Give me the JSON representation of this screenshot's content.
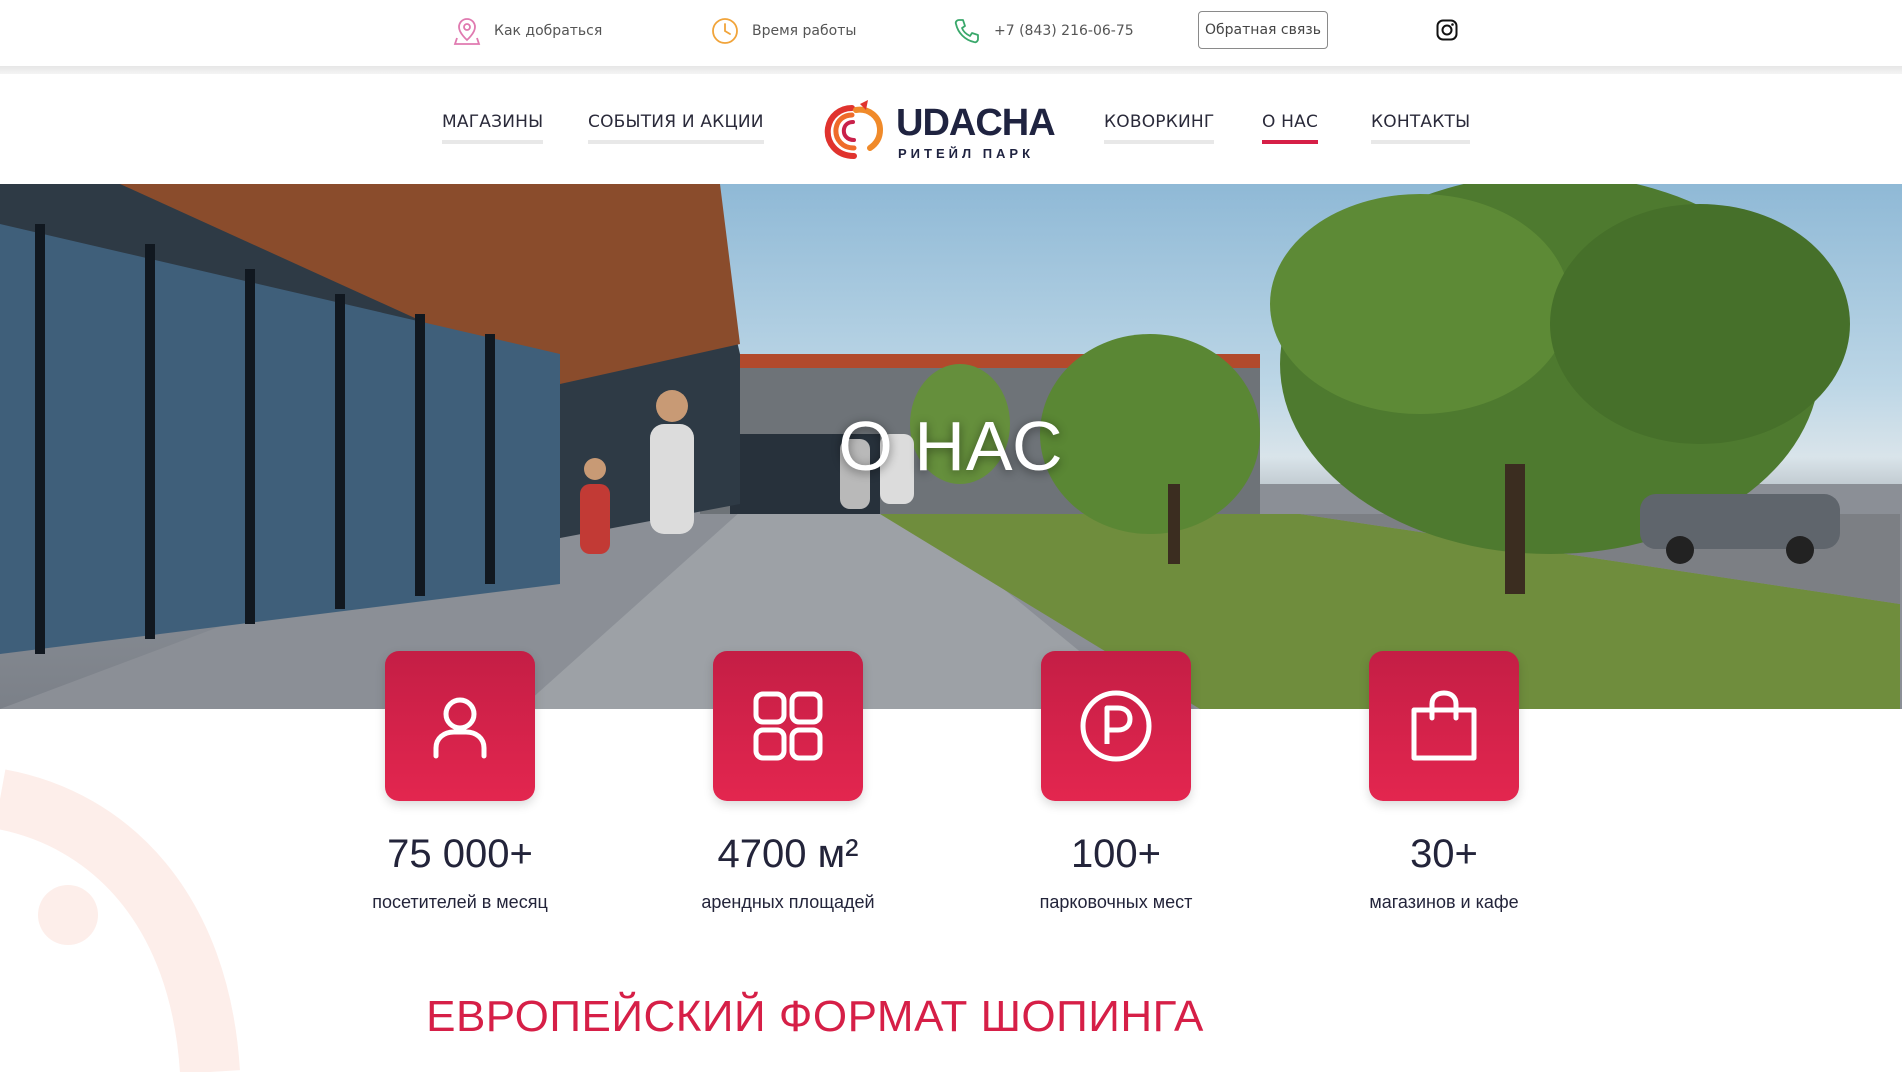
{
  "topbar": {
    "directions_label": "Как добраться",
    "hours_label": "Время работы",
    "phone_label": "+7 (843) 216-06-75",
    "feedback_label": "Обратная связь"
  },
  "nav": {
    "items": [
      {
        "label": "МАГАЗИНЫ"
      },
      {
        "label": "СОБЫТИЯ И АКЦИИ"
      },
      {
        "label": "КОВОРКИНГ"
      },
      {
        "label": "О НАС"
      },
      {
        "label": "КОНТАКТЫ"
      }
    ],
    "active": "О НАС"
  },
  "logo": {
    "title": "UDACHA",
    "subtitle": "РИТЕЙЛ ПАРК"
  },
  "hero": {
    "title": "О НАС"
  },
  "stats": [
    {
      "icon": "person-icon",
      "value": "75 000+",
      "label": "посетителей в месяц"
    },
    {
      "icon": "grid-icon",
      "value": "4700 м²",
      "label": "арендных площадей"
    },
    {
      "icon": "parking-icon",
      "value": "100+",
      "label": "парковочных мест"
    },
    {
      "icon": "shopping-bag-icon",
      "value": "30+",
      "label": "магазинов и кафе"
    }
  ],
  "section": {
    "heading": "ЕВРОПЕЙСКИЙ ФОРМАТ ШОПИНГА"
  },
  "colors": {
    "accent": "#d61f47",
    "dark_text": "#23243a"
  }
}
